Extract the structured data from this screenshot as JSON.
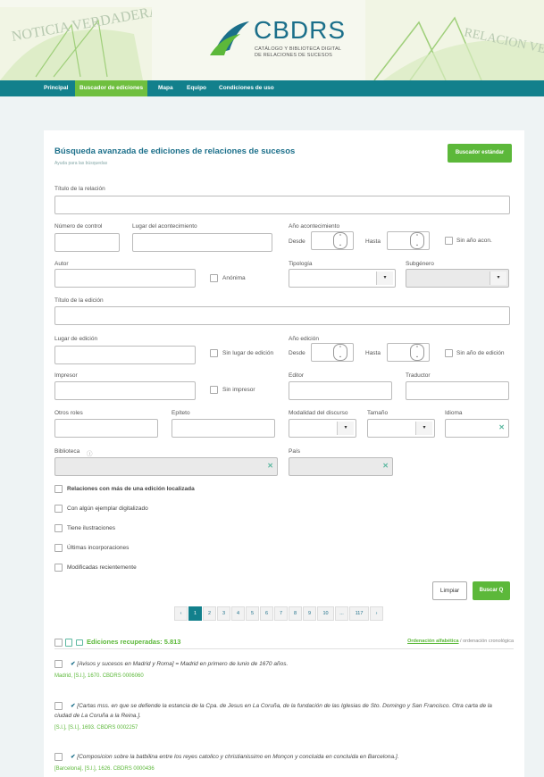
{
  "header": {
    "logo_title": "CBDRS",
    "logo_sub1": "CATÁLOGO Y BIBLIOTECA DIGITAL",
    "logo_sub2": "DE RELACIONES DE SUCESOS",
    "deco_left": "NOTICIA VERDADERA DE",
    "deco_right": "RELACION VERDADERA DEL PO"
  },
  "nav": [
    {
      "label": "Principal"
    },
    {
      "label": "Buscador de ediciones"
    },
    {
      "label": "Mapa"
    },
    {
      "label": "Equipo"
    },
    {
      "label": "Condiciones de uso"
    }
  ],
  "form": {
    "title": "Búsqueda avanzada de ediciones de relaciones de sucesos",
    "help": "Ayuda para las búsquedas",
    "standard_button": "Buscador estándar",
    "titulo_relacion": "Título de la relación",
    "numero_control": "Número de control",
    "lugar_acontecimiento": "Lugar del acontecimiento",
    "anio_acontecimiento": "Año acontecimiento",
    "desde": "Desde",
    "hasta": "Hasta",
    "sin_anio_acon": "Sin año acon.",
    "autor": "Autor",
    "anonima": "Anónima",
    "tipologia": "Tipología",
    "subgenero": "Subgénero",
    "titulo_edicion": "Título de la edición",
    "lugar_edicion": "Lugar de edición",
    "sin_lugar_edicion": "Sin lugar de edición",
    "anio_edicion": "Año edición",
    "sin_anio_edicion": "Sin año de edición",
    "impresor": "Impresor",
    "sin_impresor": "Sin impresor",
    "editor": "Editor",
    "traductor": "Traductor",
    "otros_roles": "Otros roles",
    "epiteto": "Epíteto",
    "modalidad": "Modalidad del discurso",
    "tamanio": "Tamaño",
    "idioma": "Idioma",
    "biblioteca": "Biblioteca",
    "pais": "País",
    "checks": [
      {
        "label": "Relaciones con más de una edición localizada",
        "bold": true
      },
      {
        "label": "Con algún ejemplar digitalizado",
        "bold": false
      },
      {
        "label": "Tiene ilustraciones",
        "bold": false
      },
      {
        "label": "Últimas incorporaciones",
        "bold": false
      },
      {
        "label": "Modificadas recientemente",
        "bold": false
      }
    ],
    "limpiar": "Limpiar",
    "buscar": "Buscar Q"
  },
  "pager": [
    "‹",
    "1",
    "2",
    "3",
    "4",
    "5",
    "6",
    "7",
    "8",
    "9",
    "10",
    "...",
    "117",
    "›"
  ],
  "results": {
    "count": "Ediciones recuperadas: 5.813",
    "sort_alpha": "Ordenación alfabética",
    "sort_sep": " / ",
    "sort_chrono": "ordenación cronológica",
    "records": [
      {
        "title": "[Avisos y sucesos en Madrid y Roma] = Madrid en primero de lunio de 1670 años.",
        "meta": "Madrid, [S.l.], 1670. CBDRS 0006060"
      },
      {
        "title": "[Cartas mss. en que se defiende la estancia de la Cpa. de Jesus en La Coruña, de la fundación de las Iglesias de Sto. Domingo y San Francisco. Otra carta de la ciudad de La Coruña a la Reina.].",
        "meta": "[S.l.], [S.l.], 1693. CBDRS 0002257"
      },
      {
        "title": "[Composicion sobre la batbilina entre los reyes catolico y christianissimo en Monçon y concluida en concluida en Barcelona.].",
        "meta": "[Barcelona], [S.l.], 1626. CBDRS 0000436"
      }
    ]
  }
}
